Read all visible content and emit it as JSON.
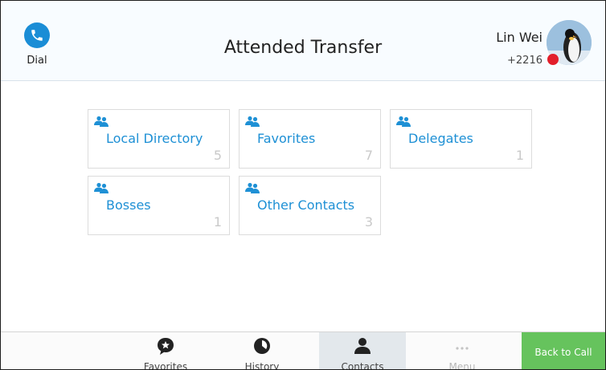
{
  "header": {
    "dial_label": "Dial",
    "title": "Attended Transfer",
    "user_name": "Lin Wei",
    "user_ext": "+2216",
    "status_color": "#e21f2b"
  },
  "tiles": [
    {
      "label": "Local Directory",
      "count": "5",
      "icon": "contacts-group-icon"
    },
    {
      "label": "Favorites",
      "count": "7",
      "icon": "contacts-group-icon"
    },
    {
      "label": "Delegates",
      "count": "1",
      "icon": "contacts-group-icon"
    },
    {
      "label": "Bosses",
      "count": "1",
      "icon": "contacts-group-icon"
    },
    {
      "label": "Other Contacts",
      "count": "3",
      "icon": "contacts-group-icon"
    }
  ],
  "footer": {
    "favorites": "Favorites",
    "history": "History",
    "contacts": "Contacts",
    "menu": "Menu",
    "back_to_call": "Back to Call"
  },
  "colors": {
    "accent": "#1e90d5",
    "back_to_call": "#66c35d",
    "active_tab": "#e3e8ec"
  }
}
